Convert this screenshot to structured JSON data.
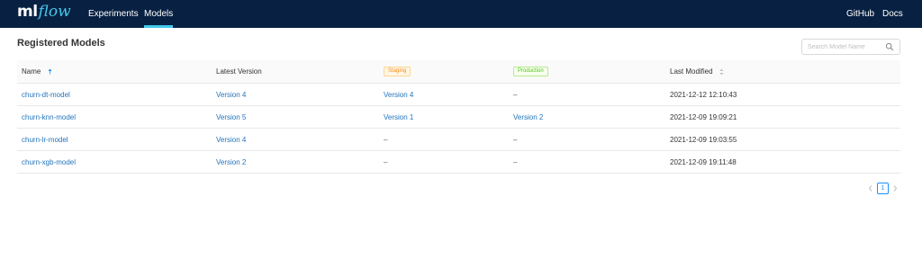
{
  "header": {
    "logo_ml": "ml",
    "logo_flow": "flow",
    "nav_experiments": "Experiments",
    "nav_models": "Models",
    "nav_github": "GitHub",
    "nav_docs": "Docs",
    "brand_color": "#082142",
    "accent_color": "#43c9ed"
  },
  "page": {
    "title": "Registered Models",
    "search_placeholder": "Search Model Name",
    "search_icon": "search-icon"
  },
  "table": {
    "columns": {
      "name": "Name",
      "latest_version": "Latest Version",
      "staging": "Staging",
      "production": "Production",
      "last_modified": "Last Modified"
    },
    "rows": [
      {
        "name": "churn-dt-model",
        "latest": "Version 4",
        "staging": "Version 4",
        "production": "–",
        "modified": "2021-12-12 12:10:43"
      },
      {
        "name": "churn-knn-model",
        "latest": "Version 5",
        "staging": "Version 1",
        "production": "Version 2",
        "modified": "2021-12-09 19:09:21"
      },
      {
        "name": "churn-lr-model",
        "latest": "Version 4",
        "staging": "–",
        "production": "–",
        "modified": "2021-12-09 19:03:55"
      },
      {
        "name": "churn-xgb-model",
        "latest": "Version 2",
        "staging": "–",
        "production": "–",
        "modified": "2021-12-09 19:11:48"
      }
    ]
  },
  "pagination": {
    "current_page": "1"
  }
}
